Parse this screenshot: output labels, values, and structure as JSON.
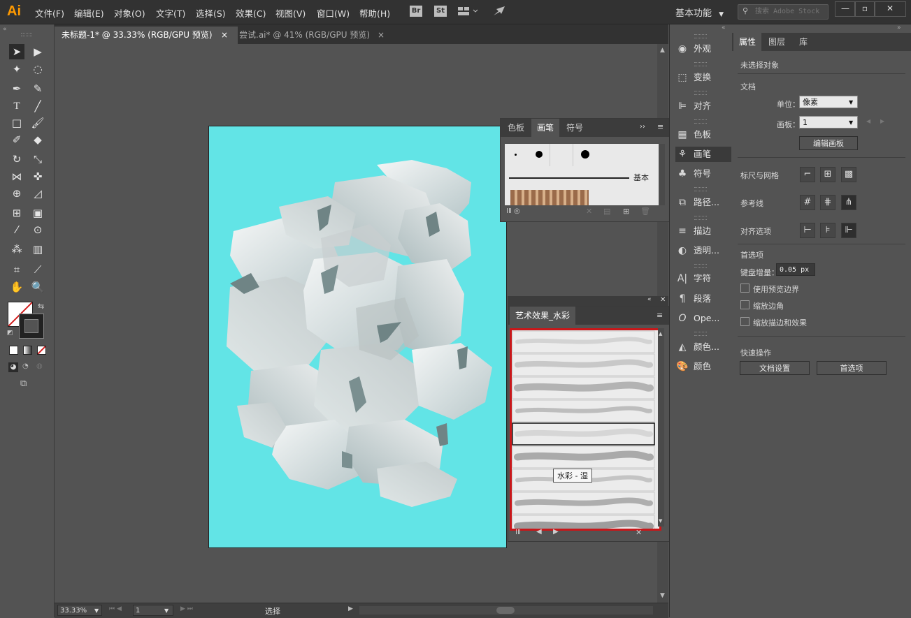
{
  "app": {
    "logo": "Ai"
  },
  "menu": [
    "文件(F)",
    "编辑(E)",
    "对象(O)",
    "文字(T)",
    "选择(S)",
    "效果(C)",
    "视图(V)",
    "窗口(W)",
    "帮助(H)"
  ],
  "menubar": {
    "bridge": "Br",
    "stock": "St",
    "workspace": "基本功能",
    "search_placeholder": "搜索 Adobe Stock"
  },
  "tabs": [
    {
      "label": "未标题-1* @ 33.33% (RGB/GPU 预览)",
      "close": "×",
      "active": true
    },
    {
      "label": "尝试.ai* @ 41% (RGB/GPU 预览)",
      "close": "×",
      "active": false
    }
  ],
  "status": {
    "zoom": "33.33%",
    "artboard": "1",
    "tool": "选择"
  },
  "brushes_panel": {
    "tabs": [
      "色板",
      "画笔",
      "符号"
    ],
    "active_tab": "画笔",
    "basic_label": "基本"
  },
  "art_panel": {
    "title": "艺术效果_水彩",
    "tooltip": "水彩 - 湿",
    "selected_index": 4,
    "stroke_count": 9
  },
  "dock": [
    "外观",
    "变换",
    "对齐",
    "色板",
    "画笔",
    "符号",
    "路径...",
    "描边",
    "透明...",
    "字符",
    "段落",
    "Ope...",
    "颜色...",
    "颜色"
  ],
  "props": {
    "tabs": [
      "属性",
      "图层",
      "库"
    ],
    "active_tab": "属性",
    "no_selection": "未选择对象",
    "document": "文档",
    "units_label": "单位：",
    "units_value": "像素",
    "artboard_label": "画板：",
    "artboard_value": "1",
    "edit_artboards": "编辑画板",
    "rulers_grids": "标尺与网格",
    "guides": "参考线",
    "align_options": "对齐选项",
    "preferences": "首选项",
    "keyboard_increment_label": "键盘增量：",
    "keyboard_increment_value": "0.05 px",
    "use_preview_bounds": "使用预览边界",
    "scale_corners": "缩放边角",
    "scale_strokes_effects": "缩放描边和效果",
    "quick_actions": "快速操作",
    "document_setup": "文档设置",
    "preferences_btn": "首选项"
  },
  "colors": {
    "artboard": "#62e4e6",
    "highlight": "#d11f1f",
    "accent": "#ff9a00"
  }
}
